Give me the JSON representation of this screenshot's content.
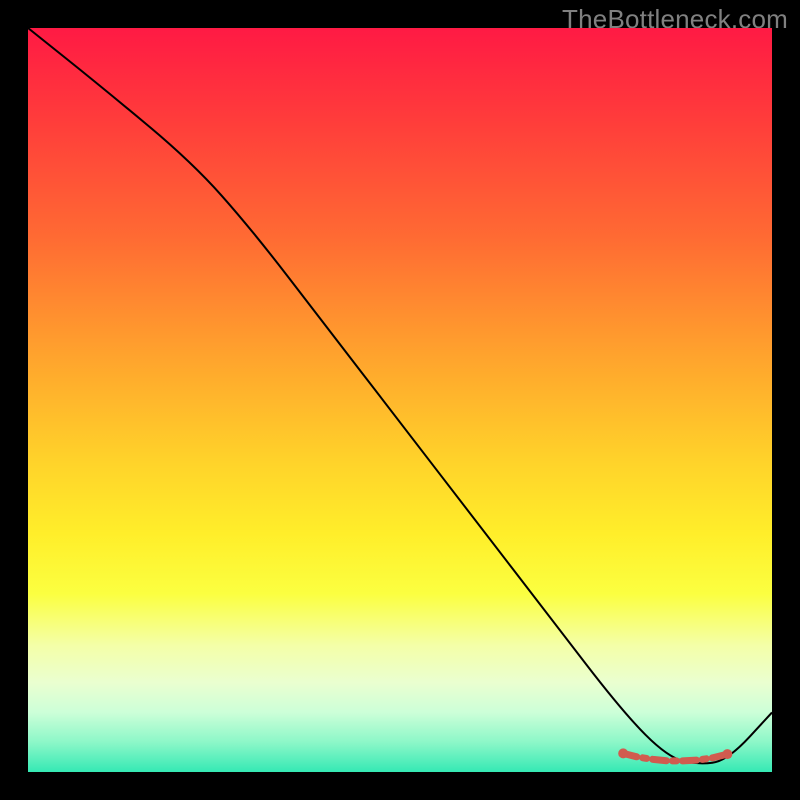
{
  "watermark": "TheBottleneck.com",
  "chart_data": {
    "type": "line",
    "title": "",
    "xlabel": "",
    "ylabel": "",
    "xlim": [
      0,
      100
    ],
    "ylim": [
      0,
      100
    ],
    "series": [
      {
        "name": "black-curve",
        "x": [
          0,
          10,
          22,
          30,
          40,
          50,
          60,
          70,
          80,
          86,
          90,
          94,
          100
        ],
        "y": [
          100,
          92,
          82,
          73,
          60,
          47,
          34,
          21,
          8,
          2,
          1,
          1.5,
          8
        ]
      },
      {
        "name": "orange-flat-segment",
        "x": [
          80,
          82,
          84,
          86,
          88,
          90,
          92,
          94
        ],
        "y": [
          2.5,
          2.0,
          1.7,
          1.5,
          1.5,
          1.6,
          1.9,
          2.4
        ]
      }
    ],
    "colors": {
      "black_line": "#000000",
      "orange_segment": "#d15b4f",
      "orange_dot": "#d15b4f"
    }
  }
}
